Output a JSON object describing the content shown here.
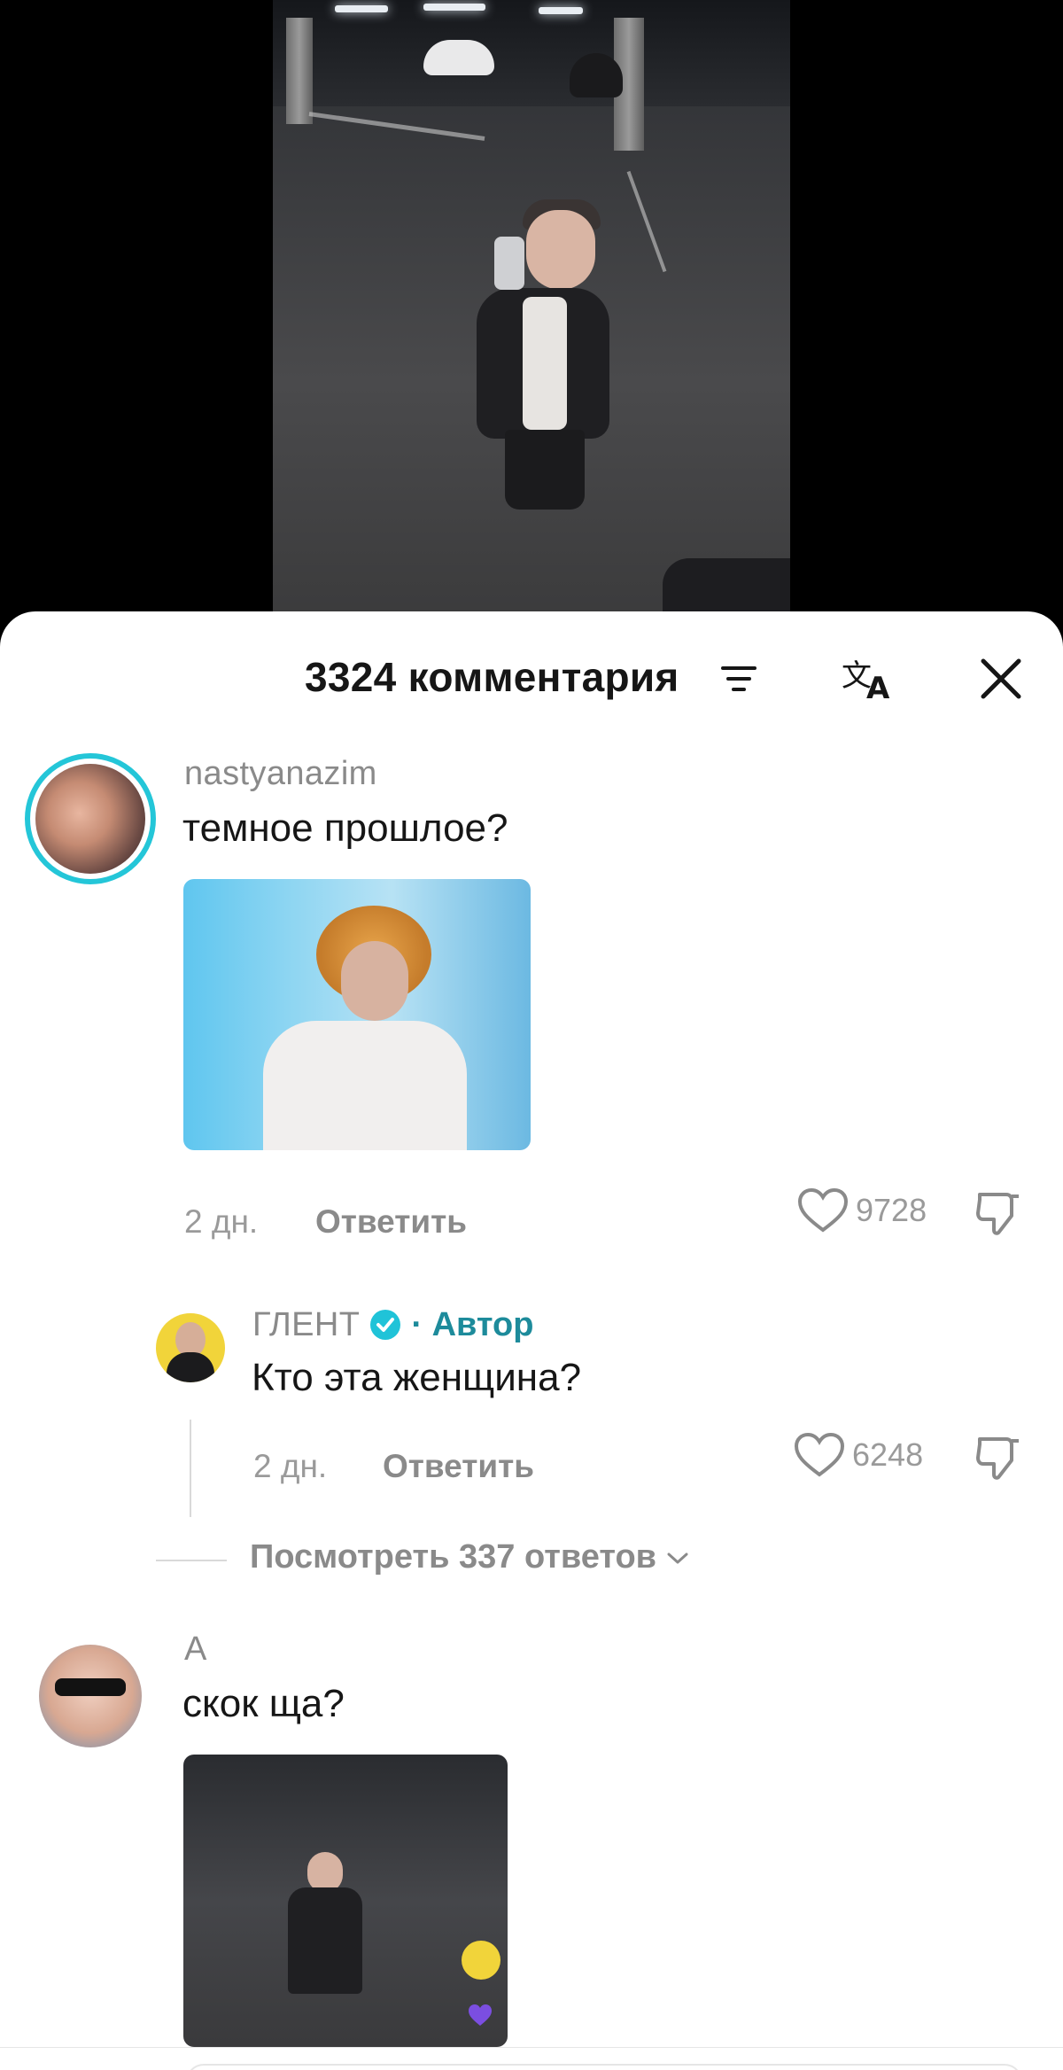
{
  "header": {
    "title": "3324 комментария",
    "icons": [
      "sort-icon",
      "translate-icon",
      "close-icon"
    ]
  },
  "comments": [
    {
      "username": "nastyanazim",
      "text": "темное прошлое?",
      "time": "2 дн.",
      "reply_label": "Ответить",
      "likes": "9728",
      "has_attachment": true
    },
    {
      "username": "ГЛЕНТ",
      "author_badge": "· Автор",
      "text": "Кто эта женщина?",
      "time": "2 дн.",
      "reply_label": "Ответить",
      "likes": "6248",
      "verified": true
    },
    {
      "username": "A",
      "text": "скок ща?",
      "has_attachment": true
    }
  ],
  "view_replies": "Посмотреть 337 ответов",
  "colors": {
    "accent_teal": "#1d8b9b",
    "avatar_ring": "#24c6d8",
    "text_primary": "#161616",
    "text_secondary": "#8a8a8a"
  }
}
